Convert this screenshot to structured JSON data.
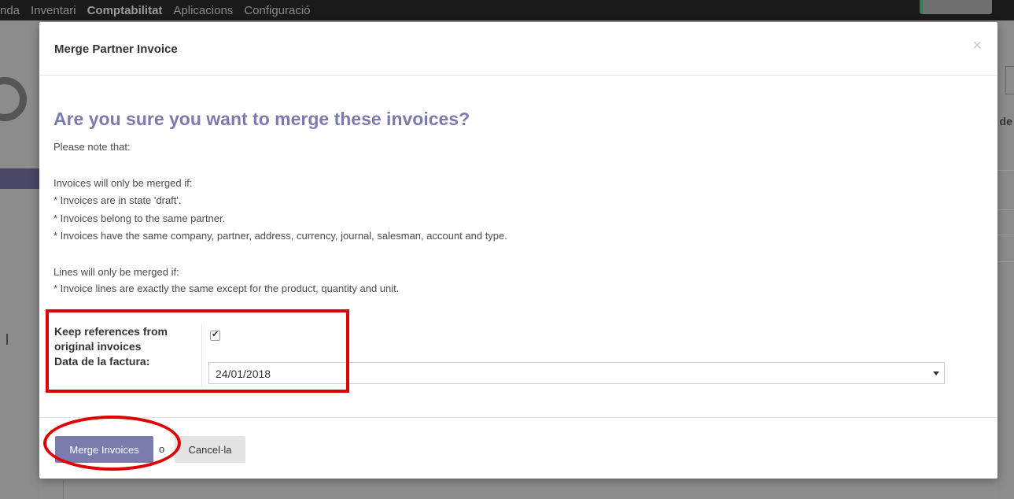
{
  "topbar": {
    "menu": [
      "nda",
      "Inventari",
      "Comptabilitat",
      "Aplicacions",
      "Configuració"
    ],
    "active_index": 2
  },
  "background": {
    "right_text": "t de"
  },
  "modal": {
    "title": "Merge Partner Invoice",
    "close_glyph": "×",
    "heading": "Are you sure you want to merge these invoices?",
    "note_lines": [
      "Please note that:",
      "Invoices will only be merged if:",
      "* Invoices are in state 'draft'.",
      "* Invoices belong to the same partner.",
      "* Invoices have the same company, partner, address, currency, journal, salesman, account and type.",
      "Lines will only be merged if:",
      "* Invoice lines are exactly the same except for the product, quantity and unit."
    ],
    "form": {
      "keep_refs_label": "Keep references from original invoices",
      "keep_refs_checked": true,
      "date_label": "Data de la factura:",
      "date_value": "24/01/2018"
    },
    "footer": {
      "merge_button": "Merge Invoices",
      "or_text": "o",
      "cancel_button": "Cancel·la"
    }
  },
  "colors": {
    "accent": "#7c7bad",
    "annotation": "#e00000",
    "overlay_bg": "#8e8e8e"
  }
}
